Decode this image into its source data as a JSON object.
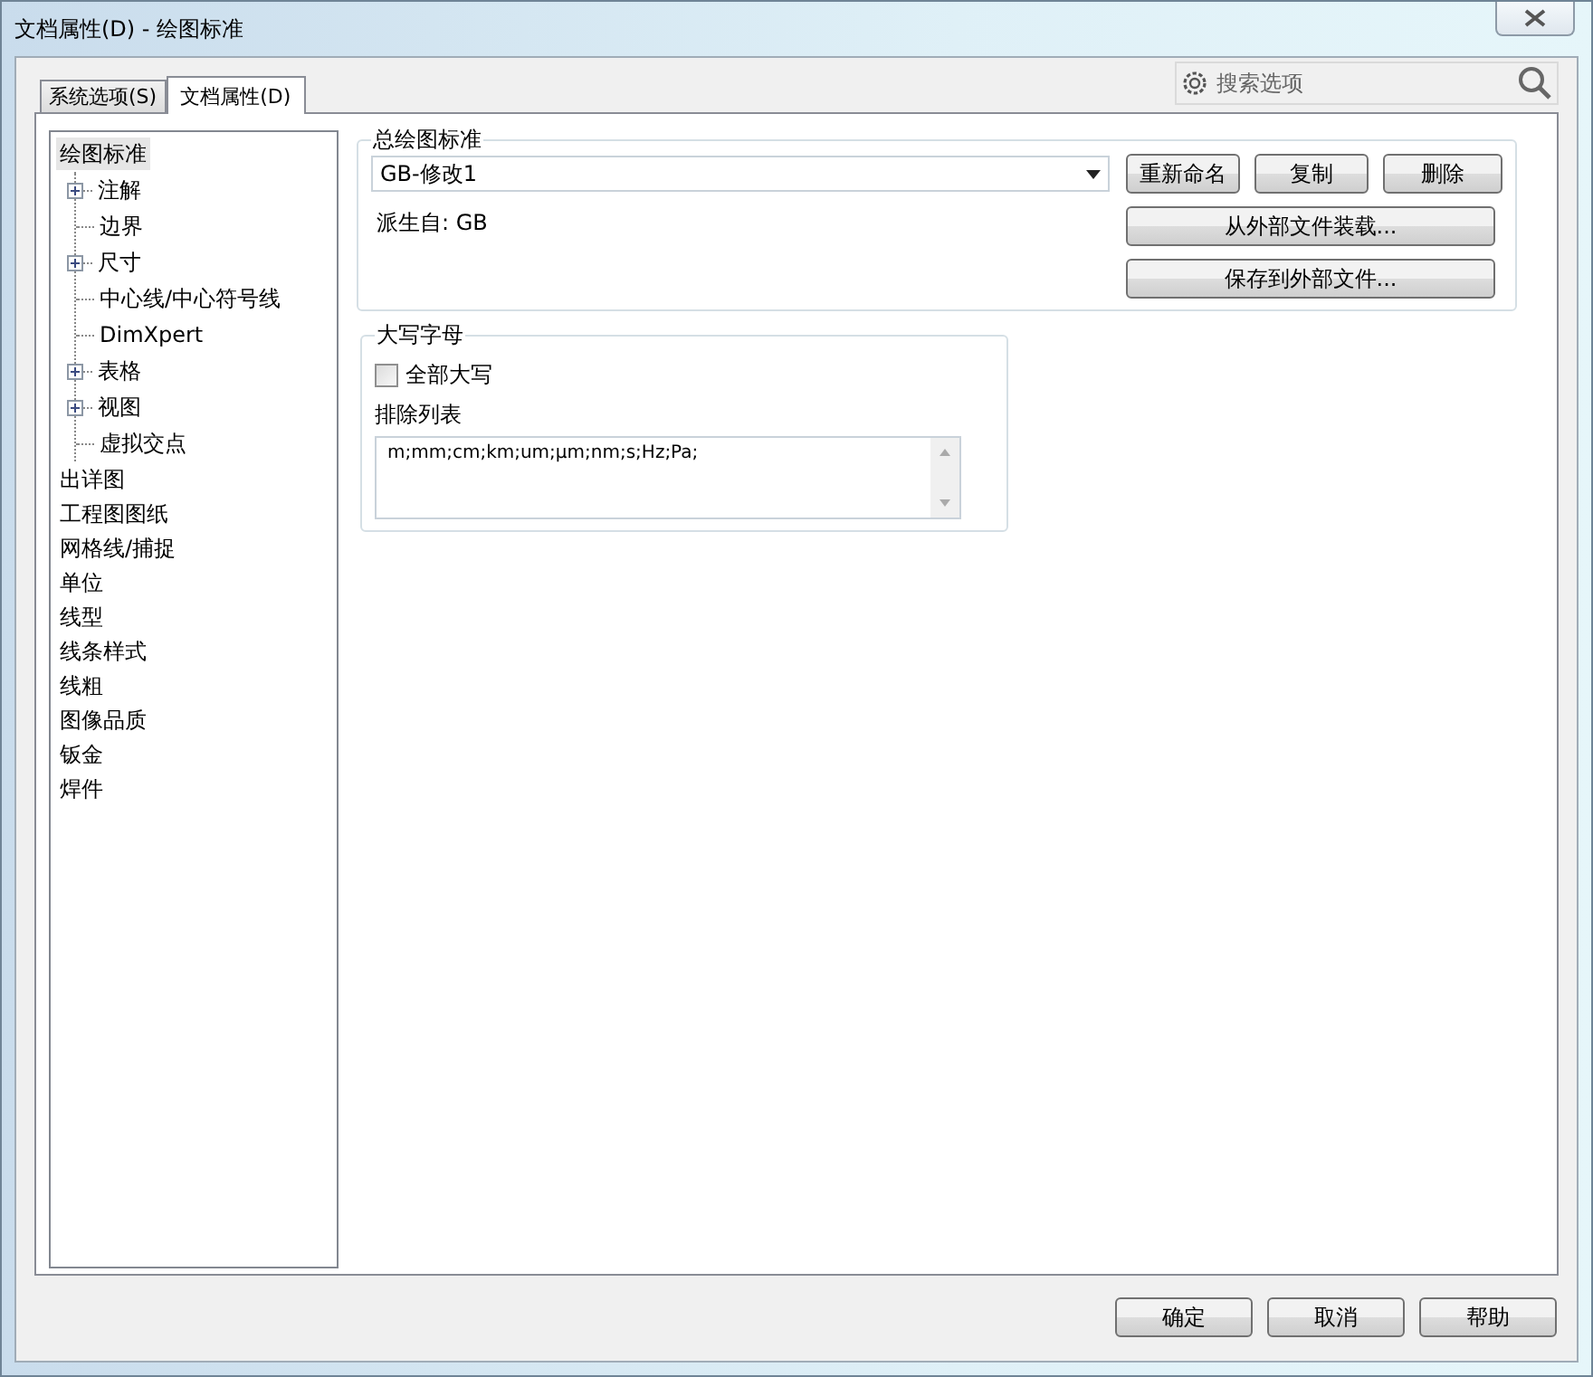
{
  "window": {
    "title": "文档属性(D) - 绘图标准"
  },
  "tabs": [
    {
      "label": "系统选项(S)",
      "selected": false
    },
    {
      "label": "文档属性(D)",
      "selected": true
    }
  ],
  "search": {
    "placeholder": "搜索选项"
  },
  "tree": [
    {
      "label": "绘图标准",
      "selected": true,
      "children": [
        {
          "label": "注解",
          "expanded": false,
          "selected": false
        },
        {
          "label": "边界",
          "selected": false
        },
        {
          "label": "尺寸",
          "expanded": false,
          "selected": false
        },
        {
          "label": "中心线/中心符号线",
          "selected": false
        },
        {
          "label": "DimXpert",
          "selected": false
        },
        {
          "label": "表格",
          "expanded": false,
          "selected": false
        },
        {
          "label": "视图",
          "expanded": false,
          "selected": false
        },
        {
          "label": "虚拟交点",
          "selected": false
        }
      ]
    },
    {
      "label": "出详图",
      "selected": false
    },
    {
      "label": "工程图图纸",
      "selected": false
    },
    {
      "label": "网格线/捕捉",
      "selected": false
    },
    {
      "label": "单位",
      "selected": false
    },
    {
      "label": "线型",
      "selected": false
    },
    {
      "label": "线条样式",
      "selected": false
    },
    {
      "label": "线粗",
      "selected": false
    },
    {
      "label": "图像品质",
      "selected": false
    },
    {
      "label": "钣金",
      "selected": false
    },
    {
      "label": "焊件",
      "selected": false
    }
  ],
  "drawing_standard": {
    "legend": "总绘图标准",
    "value": "GB-修改1",
    "derived_from": "派生自: GB",
    "buttons": [
      "重新命名",
      "复制",
      "删除"
    ],
    "wide_buttons": [
      "从外部文件装载...",
      "保存到外部文件..."
    ]
  },
  "capitals": {
    "legend": "大写字母",
    "all_caps": {
      "label": "全部大写",
      "checked": false
    },
    "exclusion_label": "排除列表",
    "exclusion_list": "m;mm;cm;km;um;µm;nm;s;Hz;Pa;"
  },
  "buttons": [
    "确定",
    "取消",
    "帮助"
  ]
}
